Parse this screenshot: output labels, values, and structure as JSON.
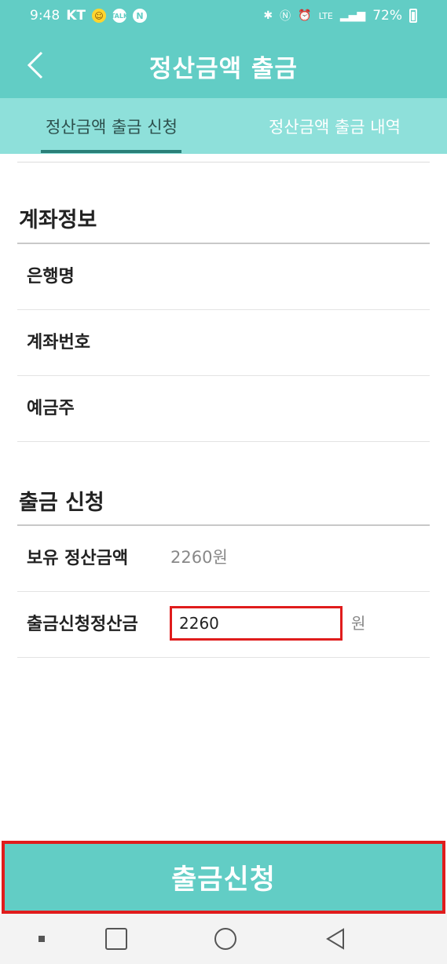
{
  "status_bar": {
    "time": "9:48",
    "carrier": "KT",
    "notifications": [
      "emoji-face-icon",
      "talk-icon",
      "naver-icon"
    ],
    "notification_texts": {
      "talk": "TALK",
      "naver": "N"
    },
    "lte": "LTE",
    "battery": "72%"
  },
  "header": {
    "title": "정산금액 출금"
  },
  "tabs": [
    {
      "label": "정산금액 출금 신청",
      "active": true
    },
    {
      "label": "정산금액 출금 내역",
      "active": false
    }
  ],
  "account_info": {
    "title": "계좌정보",
    "rows": [
      {
        "label": "은행명",
        "value": ""
      },
      {
        "label": "계좌번호",
        "value": ""
      },
      {
        "label": "예금주",
        "value": ""
      }
    ]
  },
  "withdrawal": {
    "title": "출금 신청",
    "balance_label": "보유 정산금액",
    "balance_value": "2260원",
    "request_label": "출금신청정산금",
    "request_value": "2260",
    "unit": "원"
  },
  "submit_label": "출금신청",
  "colors": {
    "primary": "#62cdc5",
    "tab_bg": "#8ee0da",
    "highlight": "#e01c1c"
  }
}
